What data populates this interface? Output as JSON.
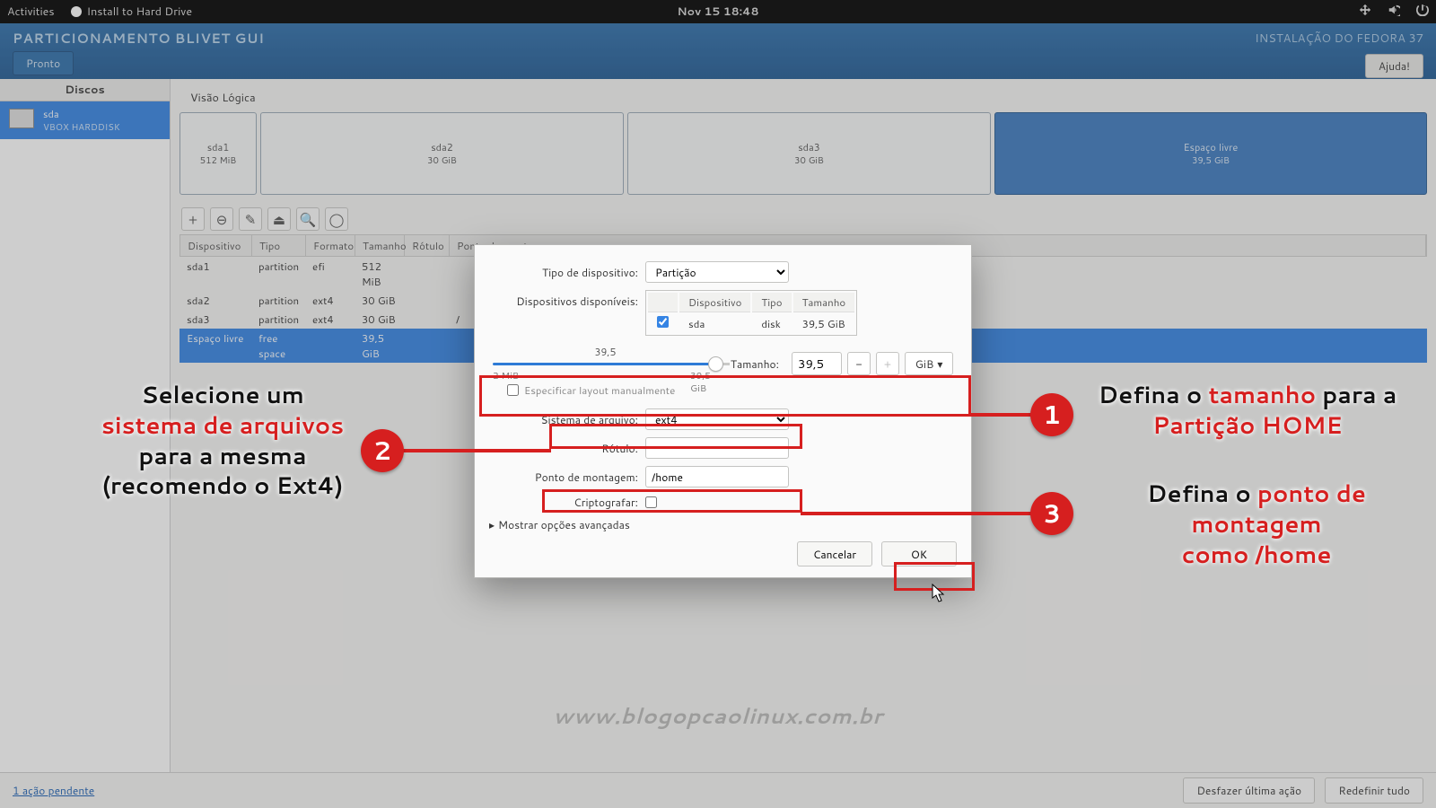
{
  "topbar": {
    "activities": "Activities",
    "app": "Install to Hard Drive",
    "clock": "Nov 15  18:48"
  },
  "header": {
    "title": "PARTICIONAMENTO BLIVET GUI",
    "subtitle": "INSTALAÇÃO DO FEDORA 37",
    "done": "Pronto",
    "help": "Ajuda!"
  },
  "sidebar": {
    "heading": "Discos",
    "disk": {
      "name": "sda",
      "model": "VBOX HARDDISK"
    }
  },
  "tab": "Visão Lógica",
  "parts": [
    {
      "name": "sda1",
      "size": "512 MiB"
    },
    {
      "name": "sda2",
      "size": "30 GiB"
    },
    {
      "name": "sda3",
      "size": "30 GiB"
    },
    {
      "name": "Espaço livre",
      "size": "39,5 GiB"
    }
  ],
  "cols": {
    "dev": "Dispositivo",
    "type": "Tipo",
    "fmt": "Formato",
    "size": "Tamanho",
    "label": "Rótulo",
    "mnt": "Ponto de montagem"
  },
  "rows": [
    {
      "dev": "sda1",
      "type": "partition",
      "fmt": "efi",
      "size": "512 MiB",
      "label": "",
      "mnt": ""
    },
    {
      "dev": "sda2",
      "type": "partition",
      "fmt": "ext4",
      "size": "30 GiB",
      "label": "",
      "mnt": ""
    },
    {
      "dev": "sda3",
      "type": "partition",
      "fmt": "ext4",
      "size": "30 GiB",
      "label": "",
      "mnt": "/"
    },
    {
      "dev": "Espaço livre",
      "type": "free space",
      "fmt": "",
      "size": "39,5 GiB",
      "label": "",
      "mnt": ""
    }
  ],
  "dialog": {
    "devtype_l": "Tipo de dispositivo:",
    "devtype": "Partição",
    "avail_l": "Dispositivos disponíveis:",
    "th": {
      "dev": "Dispositivo",
      "type": "Tipo",
      "size": "Tamanho"
    },
    "devrow": {
      "name": "sda",
      "type": "disk",
      "size": "39,5 GiB"
    },
    "slider_val": "39,5",
    "slider_min": "2 MiB",
    "slider_max": "39,5 GiB",
    "size_l": "Tamanho:",
    "size_val": "39,5",
    "unit": "GiB",
    "manual": "Especificar layout manualmente",
    "fs_l": "Sistema de arquivo:",
    "fs": "ext4",
    "label_l": "Rótulo:",
    "label_val": "",
    "mnt_l": "Ponto de montagem:",
    "mnt_val": "/home",
    "enc_l": "Criptografar:",
    "adv": "Mostrar opções avançadas",
    "cancel": "Cancelar",
    "ok": "OK"
  },
  "footer": {
    "pending": "1 ação pendente",
    "undo": "Desfazer última ação",
    "reset": "Redefinir tudo"
  },
  "ann": {
    "left1": "Selecione um",
    "left2": "sistema de arquivos",
    "left3": "para a mesma",
    "left4": "(recomendo o Ext4)",
    "r1a": "Defina o ",
    "r1b": "tamanho",
    "r1c": " para a",
    "r1d": "Partição HOME",
    "r3a": "Defina o ",
    "r3b": "ponto de montagem",
    "r3c": "como /home"
  },
  "watermark": "www.blogopcaolinux.com.br"
}
